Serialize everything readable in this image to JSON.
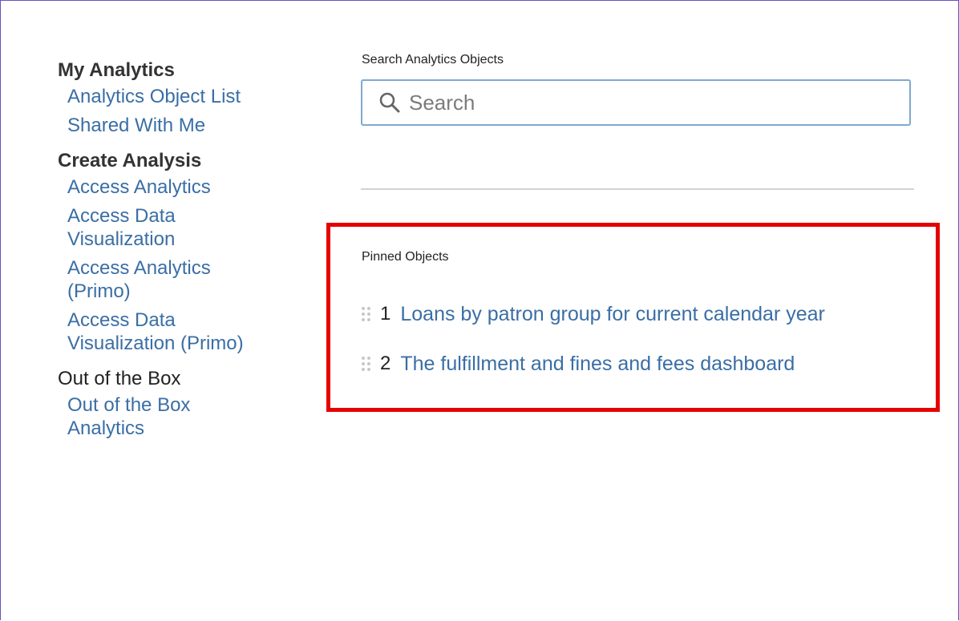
{
  "sidebar": {
    "my_analytics": {
      "heading": "My Analytics",
      "links": [
        "Analytics Object List",
        "Shared With Me"
      ]
    },
    "create_analysis": {
      "heading": "Create Analysis",
      "links": [
        "Access Analytics",
        "Access Data Visualization",
        "Access Analytics (Primo)",
        "Access Data Visualization (Primo)"
      ]
    },
    "out_of_the_box": {
      "heading": "Out of the Box",
      "links": [
        "Out of the Box Analytics"
      ]
    }
  },
  "search": {
    "label": "Search Analytics Objects",
    "placeholder": "Search",
    "value": "",
    "icon": "search-icon"
  },
  "pinned": {
    "title": "Pinned Objects",
    "items": [
      {
        "number": "1",
        "label": "Loans by patron group for current calendar year"
      },
      {
        "number": "2",
        "label": "The fulfillment and fines and fees dashboard"
      }
    ]
  },
  "colors": {
    "link": "#3a6ea5",
    "highlight_border": "#e60000",
    "frame_border": "#6a4fc7",
    "search_border": "#7fa9cf"
  }
}
